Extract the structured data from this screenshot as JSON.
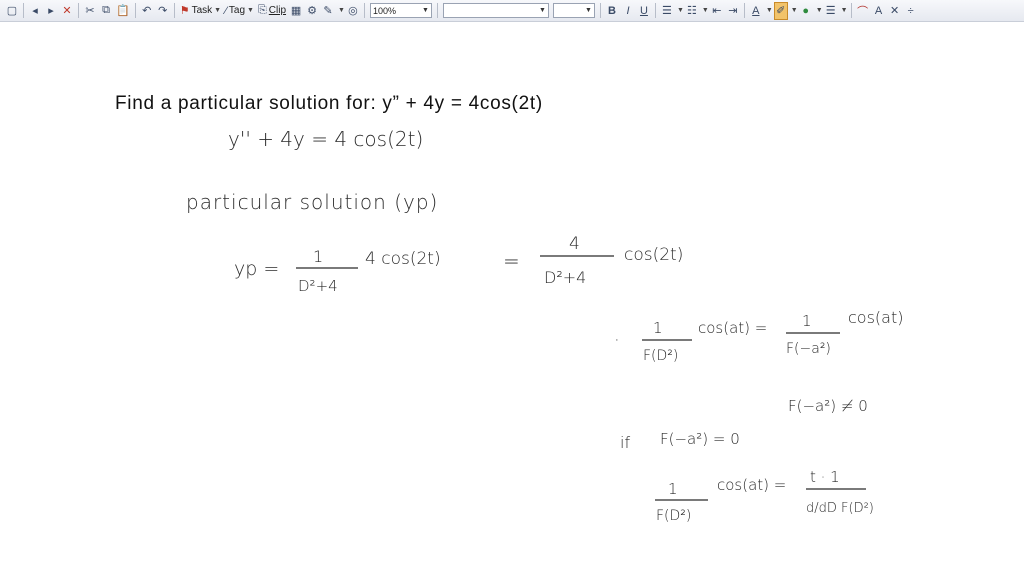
{
  "toolbar": {
    "task_label": "Task",
    "tag_label": "Tag",
    "clip_label": "Clip",
    "zoom_value": "100%",
    "font_name_value": "",
    "font_size_value": "",
    "bold_label": "B",
    "italic_label": "I",
    "underline_label": "U",
    "font_color_label": "A",
    "text_size_label": "A"
  },
  "note": {
    "title": "Find a particular solution for: y” + 4y = 4cos(2t)",
    "handwriting": {
      "equation": "y'' + 4y = 4 cos(2t)",
      "heading": "particular solution (yp)",
      "yp_lhs": "yp =",
      "f1_num": "1",
      "f1_den": "D²+4",
      "f1_tail": "4 cos(2t)",
      "eq_sign": "=",
      "f2_num": "4",
      "f2_den": "D²+4",
      "f2_tail": "cos(2t)",
      "bullet": "·",
      "r1_num": "1",
      "r1_den": "F(D²)",
      "r1_mid": "cos(at) =",
      "r1_num2": "1",
      "r1_den2": "F(−a²)",
      "r1_tail": "cos(at)",
      "cond1": "F(−a²) ≠ 0",
      "if_label": "if",
      "cond2": "F(−a²) = 0",
      "r2_num": "1",
      "r2_den": "F(D²)",
      "r2_mid": "cos(at) =",
      "r2_num2": "t · 1",
      "r2_den2": "d/dD F(D²)"
    }
  }
}
